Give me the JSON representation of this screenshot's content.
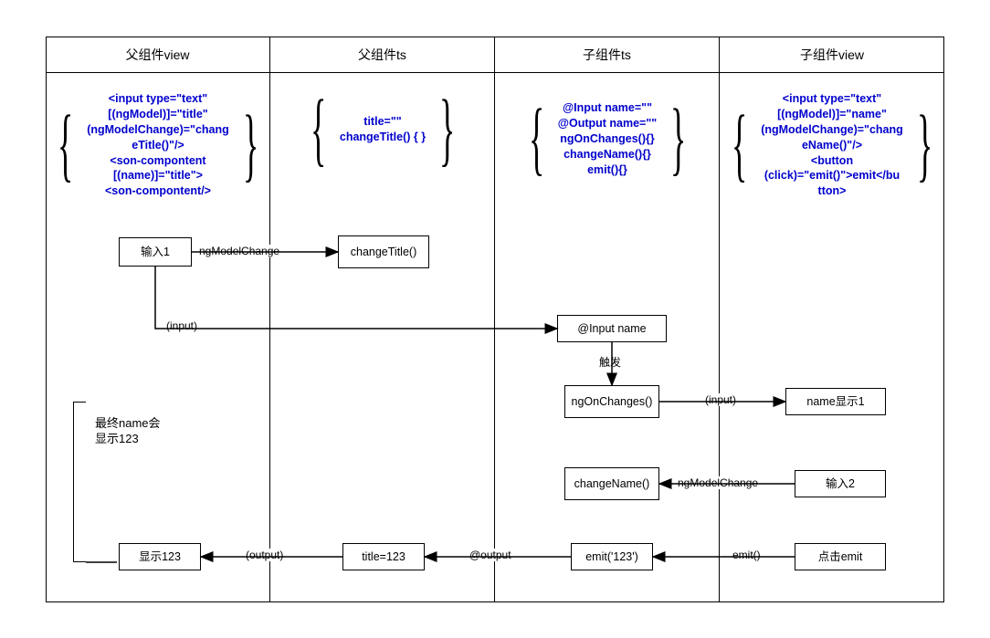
{
  "columns": {
    "col1": "父组件view",
    "col2": "父组件ts",
    "col3": "子组件ts",
    "col4": "子组件view"
  },
  "code": {
    "col1": "<input type=\"text\"\n[(ngModel)]=\"title\"\n(ngModelChange)=\"chang\neTitle()\"/>\n<son-compontent\n[(name)]=\"title\">\n<son-compontent/>",
    "col2": "title=\"\"\nchangeTitle() { }",
    "col3": "@Input name=\"\"\n@Output name=\"\"\nngOnChanges(){}\nchangeName(){}\nemit(){}",
    "col4": "<input type=\"text\"\n[(ngModel)]=\"name\"\n(ngModelChange)=\"chang\neName()\"/>\n<button\n(click)=\"emit()\">emit</bu\ntton>"
  },
  "nodes": {
    "input1": "输入1",
    "changeTitle": "changeTitle()",
    "inputName": "@Input name",
    "ngOnChanges": "ngOnChanges()",
    "nameShow1": "name显示1",
    "changeName": "changeName()",
    "input2": "输入2",
    "emitCall": "emit('123')",
    "clickEmit": "点击emit",
    "titleEq": "title=123",
    "show123": "显示123"
  },
  "labels": {
    "ngModelChange": "ngModelChange",
    "input": "(input)",
    "trigger": "触发",
    "output": "(output)",
    "atOutput": "@output",
    "emitFn": "emit()"
  },
  "note": "最终name会\n显示123"
}
